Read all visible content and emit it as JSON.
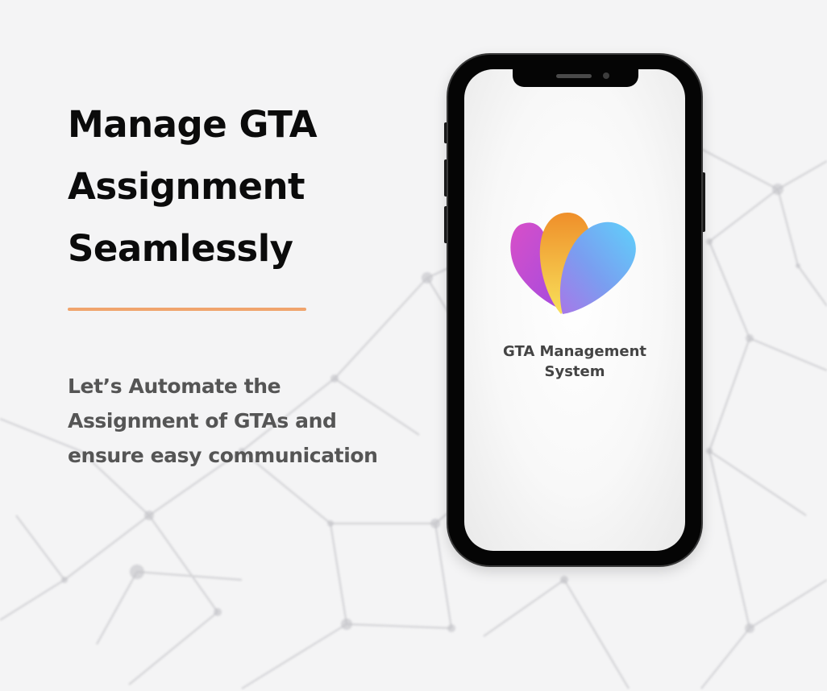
{
  "hero": {
    "headline_lines": [
      "Manage GTA",
      "Assignment",
      "Seamlessly"
    ],
    "subtext_lines": [
      "Let’s Automate the",
      "Assignment of GTAs and",
      "ensure easy communication"
    ]
  },
  "phone": {
    "app_name_lines": [
      "GTA Management",
      "System"
    ],
    "logo": "gradient-petals-logo"
  },
  "colors": {
    "divider": "#f0a46d",
    "headline": "#0b0b0b",
    "subtext": "#555555",
    "app_name": "#444444",
    "logo_magenta": "#c94bd0",
    "logo_orange": "#ee9a2c",
    "logo_blue": "#5ec8f8"
  }
}
